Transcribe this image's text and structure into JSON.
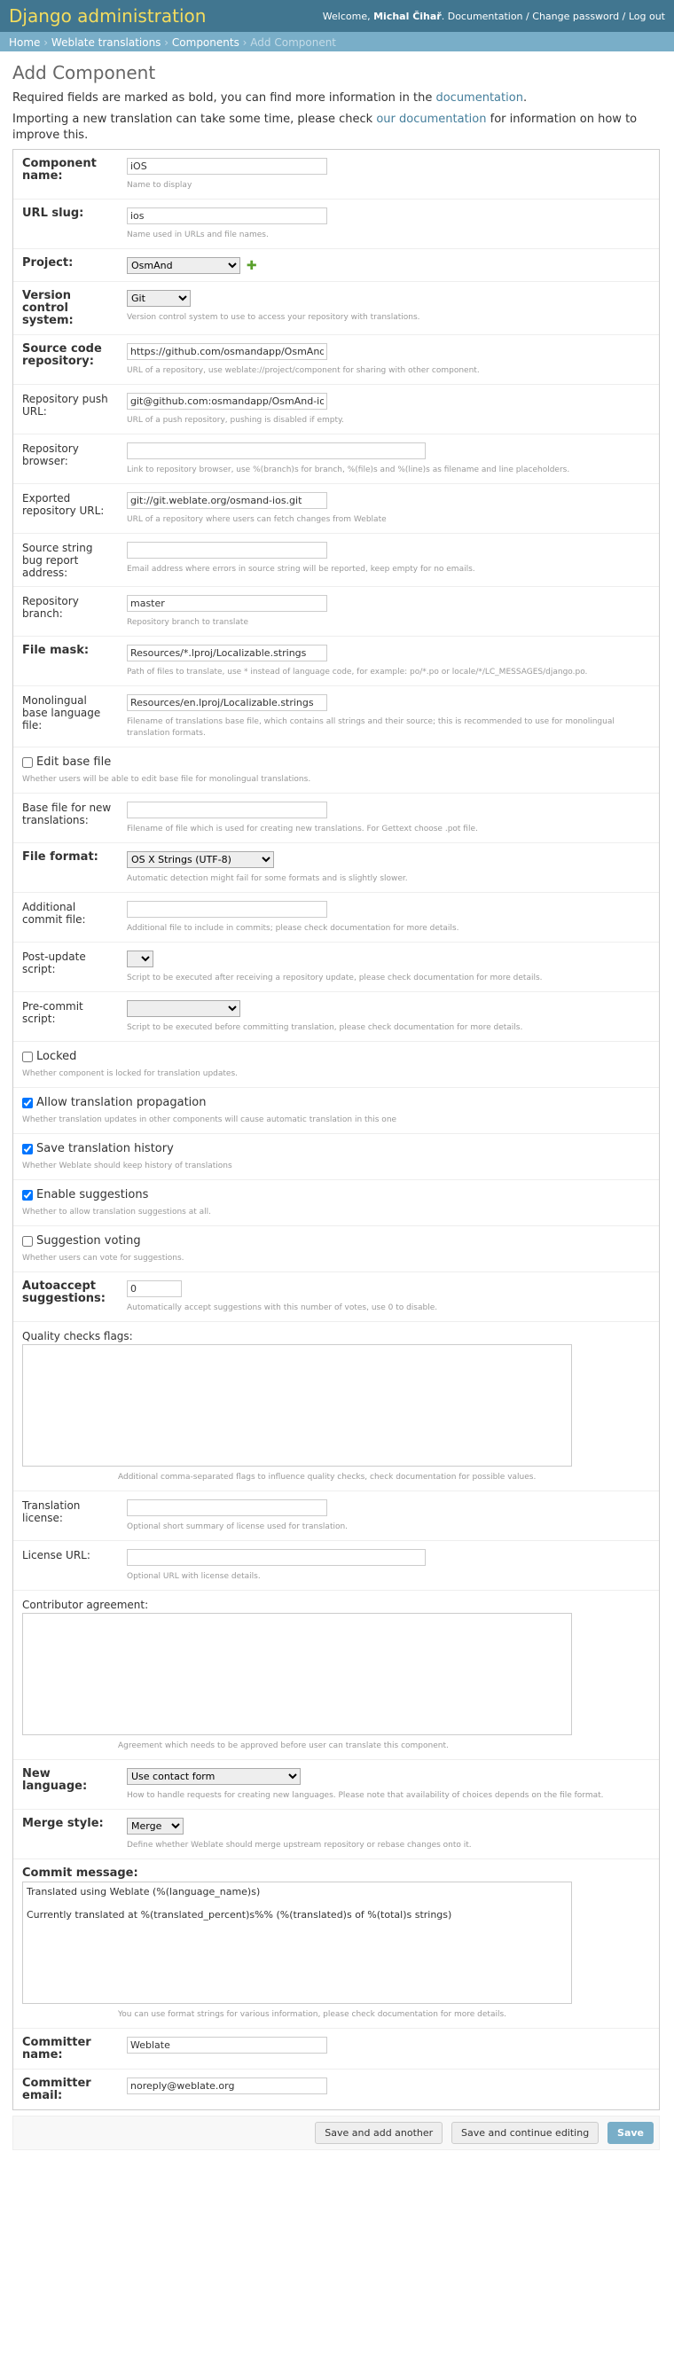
{
  "header": {
    "site_name": "Django administration",
    "welcome": "Welcome,",
    "user": "Michal Čihař",
    "documentation": "Documentation",
    "change_password": "Change password",
    "logout": "Log out",
    "sep": "/"
  },
  "breadcrumbs": {
    "home": "Home",
    "app": "Weblate translations",
    "model": "Components",
    "current": "Add Component",
    "sep": "›"
  },
  "page": {
    "title": "Add Component",
    "intro1_before": "Required fields are marked as bold, you can find more information in the ",
    "intro1_link": "documentation",
    "intro1_after": ".",
    "intro2_before": "Importing a new translation can take some time, please check ",
    "intro2_link": "our documentation",
    "intro2_after": " for information on how to improve this."
  },
  "form": {
    "name": {
      "label": "Component name:",
      "value": "iOS",
      "help": "Name to display"
    },
    "slug": {
      "label": "URL slug:",
      "value": "ios",
      "help": "Name used in URLs and file names."
    },
    "project": {
      "label": "Project:",
      "value": "OsmAnd"
    },
    "vcs": {
      "label": "Version control system:",
      "value": "Git",
      "help": "Version control system to use to access your repository with translations."
    },
    "repo": {
      "label": "Source code repository:",
      "value": "https://github.com/osmandapp/OsmAnd-ios.git",
      "help": "URL of a repository, use weblate://project/component for sharing with other component."
    },
    "push": {
      "label": "Repository push URL:",
      "value": "git@github.com:osmandapp/OsmAnd-ios.git",
      "help": "URL of a push repository, pushing is disabled if empty."
    },
    "browser": {
      "label": "Repository browser:",
      "value": "",
      "help": "Link to repository browser, use %(branch)s for branch, %(file)s and %(line)s as filename and line placeholders."
    },
    "export": {
      "label": "Exported repository URL:",
      "value": "git://git.weblate.org/osmand-ios.git",
      "help": "URL of a repository where users can fetch changes from Weblate"
    },
    "report": {
      "label": "Source string bug report address:",
      "value": "",
      "help": "Email address where errors in source string will be reported, keep empty for no emails."
    },
    "branch": {
      "label": "Repository branch:",
      "value": "master",
      "help": "Repository branch to translate"
    },
    "filemask": {
      "label": "File mask:",
      "value": "Resources/*.lproj/Localizable.strings",
      "help": "Path of files to translate, use * instead of language code, for example: po/*.po or locale/*/LC_MESSAGES/django.po."
    },
    "template": {
      "label": "Monolingual base language file:",
      "value": "Resources/en.lproj/Localizable.strings",
      "help": "Filename of translations base file, which contains all strings and their source; this is recommended to use for monolingual translation formats."
    },
    "edit_template": {
      "label": "Edit base file",
      "help": "Whether users will be able to edit base file for monolingual translations."
    },
    "new_base": {
      "label": "Base file for new translations:",
      "value": "",
      "help": "Filename of file which is used for creating new translations. For Gettext choose .pot file."
    },
    "file_format": {
      "label": "File format:",
      "value": "OS X Strings (UTF-8)",
      "help": "Automatic detection might fail for some formats and is slightly slower."
    },
    "extra_commit": {
      "label": "Additional commit file:",
      "value": "",
      "help": "Additional file to include in commits; please check documentation for more details."
    },
    "post_update": {
      "label": "Post-update script:",
      "value": "",
      "help": "Script to be executed after receiving a repository update, please check documentation for more details."
    },
    "pre_commit": {
      "label": "Pre-commit script:",
      "value": "",
      "help": "Script to be executed before committing translation, please check documentation for more details."
    },
    "locked": {
      "label": "Locked",
      "help": "Whether component is locked for translation updates."
    },
    "propagation": {
      "label": "Allow translation propagation",
      "help": "Whether translation updates in other components will cause automatic translation in this one"
    },
    "history": {
      "label": "Save translation history",
      "help": "Whether Weblate should keep history of translations"
    },
    "suggestions": {
      "label": "Enable suggestions",
      "help": "Whether to allow translation suggestions at all."
    },
    "voting": {
      "label": "Suggestion voting",
      "help": "Whether users can vote for suggestions."
    },
    "autoaccept": {
      "label": "Autoaccept suggestions:",
      "value": "0",
      "help": "Automatically accept suggestions with this number of votes, use 0 to disable."
    },
    "check_flags": {
      "label": "Quality checks flags:",
      "value": "",
      "help": "Additional comma-separated flags to influence quality checks, check documentation for possible values."
    },
    "license": {
      "label": "Translation license:",
      "value": "",
      "help": "Optional short summary of license used for translation."
    },
    "license_url": {
      "label": "License URL:",
      "value": "",
      "help": "Optional URL with license details."
    },
    "agreement": {
      "label": "Contributor agreement:",
      "value": "",
      "help": "Agreement which needs to be approved before user can translate this component."
    },
    "new_lang": {
      "label": "New language:",
      "value": "Use contact form",
      "help": "How to handle requests for creating new languages. Please note that availability of choices depends on the file format."
    },
    "merge_style": {
      "label": "Merge style:",
      "value": "Merge",
      "help": "Define whether Weblate should merge upstream repository or rebase changes onto it."
    },
    "commit_message": {
      "label": "Commit message:",
      "value": "Translated using Weblate (%(language_name)s)\n\nCurrently translated at %(translated_percent)s%% (%(translated)s of %(total)s strings)",
      "help": "You can use format strings for various information, please check documentation for more details."
    },
    "committer_name": {
      "label": "Committer name:",
      "value": "Weblate"
    },
    "committer_email": {
      "label": "Committer email:",
      "value": "noreply@weblate.org"
    }
  },
  "submit": {
    "save_add": "Save and add another",
    "save_continue": "Save and continue editing",
    "save": "Save"
  },
  "colors": {
    "header": "#417690",
    "breadcrumbs": "#79aec8",
    "brand_text": "#f5dd5d",
    "link": "#447e9b"
  },
  "icons": {
    "add": "add-icon"
  }
}
